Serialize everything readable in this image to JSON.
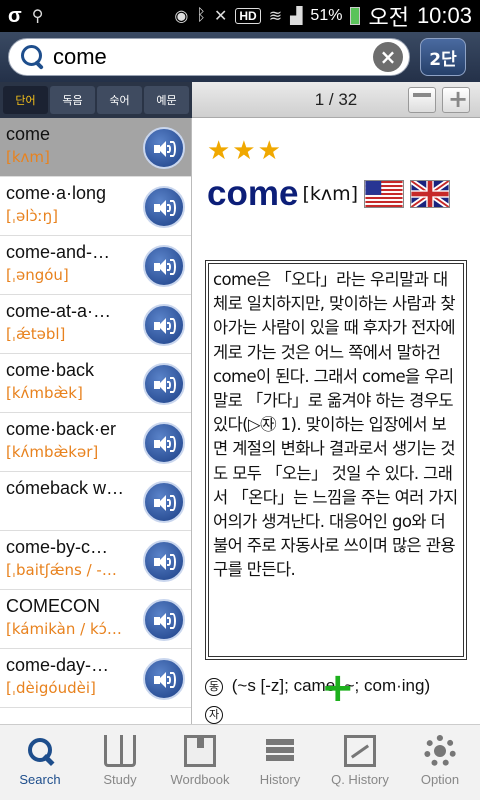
{
  "status_bar": {
    "battery_percent": "51%",
    "time_period": "오전",
    "time": "10:03",
    "hd_label": "HD"
  },
  "search": {
    "query": "come",
    "level_button": "2단"
  },
  "filter_tabs": [
    {
      "label": "단어",
      "active": true
    },
    {
      "label": "독음",
      "active": false
    },
    {
      "label": "숙어",
      "active": false
    },
    {
      "label": "예문",
      "active": false
    }
  ],
  "pager": {
    "text": "1 / 32"
  },
  "word_list": [
    {
      "word": "come",
      "pron": "[kʌm]",
      "selected": true
    },
    {
      "word": "come·a·long",
      "pron": "[ˌəlɔ̀ːŋ]",
      "selected": false
    },
    {
      "word": "come-and-…",
      "pron": "[ˌəngóu]",
      "selected": false
    },
    {
      "word": "come-at-a·…",
      "pron": "[ˌǽtəbl]",
      "selected": false
    },
    {
      "word": "come·back",
      "pron": "[kʌ́mbæ̀k]",
      "selected": false
    },
    {
      "word": "come·back·er",
      "pron": "[kʌ́mbæ̀kər]",
      "selected": false
    },
    {
      "word": "cómeback w…",
      "pron": "",
      "selected": false
    },
    {
      "word": "come-by-c…",
      "pron": "[ˌbaitʃǽns / -…",
      "selected": false
    },
    {
      "word": "COMECON",
      "pron": "[kámikàn / kɔ́…",
      "selected": false
    },
    {
      "word": "come-day-…",
      "pron": "[ˌdèigóudèi]",
      "selected": false
    }
  ],
  "detail": {
    "stars": "★★★",
    "headword": "come",
    "pron": "[kʌm]",
    "description": "come은 「오다」라는 우리말과 대체로 일치하지만, 맞이하는 사람과 찾아가는 사람이 있을 때 후자가 전자에게로 가는 것은 어느 쪽에서 말하건 come이 된다. 그래서 come을 우리말로 「가다」로 옮겨야 하는 경우도 있다(▷㉶ 1). 맞이하는 입장에서 보면 계절의 변화나 결과로서 생기는 것도 모두 「오는」 것일 수 있다. 그래서 「온다」는 느낌을 주는 여러 가지 어의가 생겨난다. 대응어인 go와 더불어 주로 자동사로 쓰이며 많은 관용구를 만든다.",
    "pos_badge": "동",
    "conjugation": "(~s [-z]; came; ~; com·ing)",
    "pos_badge_2": "자"
  },
  "bottom_nav": [
    {
      "label": "Search",
      "icon": "search-icon",
      "active": true
    },
    {
      "label": "Study",
      "icon": "book-icon",
      "active": false
    },
    {
      "label": "Wordbook",
      "icon": "wordbook-icon",
      "active": false
    },
    {
      "label": "History",
      "icon": "history-icon",
      "active": false
    },
    {
      "label": "Q. History",
      "icon": "chart-icon",
      "active": false
    },
    {
      "label": "Option",
      "icon": "gear-icon",
      "active": false
    }
  ],
  "colors": {
    "accent": "#1e4e8c",
    "pron": "#e8821e",
    "stars": "#f0a800",
    "headword": "#0c1e78"
  }
}
